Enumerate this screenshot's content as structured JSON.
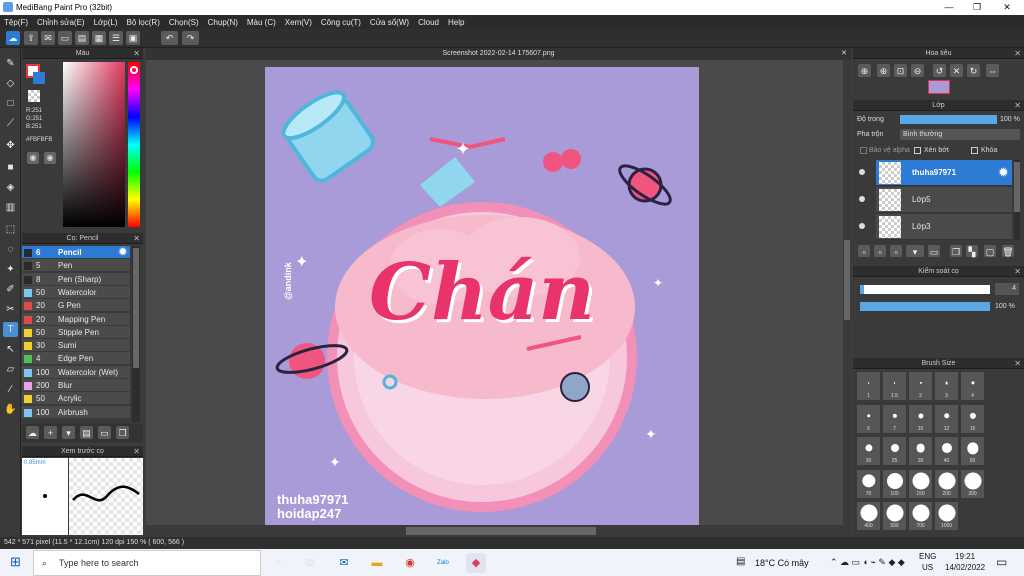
{
  "window": {
    "title": "MediBang Paint Pro (32bit)",
    "min": "—",
    "max": "❐",
    "close": "✕"
  },
  "menu": [
    "Tệp(F)",
    "Chỉnh sửa(E)",
    "Lớp(L)",
    "Bộ lọc(R)",
    "Chọn(S)",
    "Chụp(N)",
    "Màu (C)",
    "Xem(V)",
    "Công cụ(T)",
    "Cửa sổ(W)",
    "Cloud",
    "Help"
  ],
  "color_panel": {
    "title": "Màu",
    "r": "R:251",
    "g": "G:251",
    "b": "B:251",
    "hex": "#FBFBFB"
  },
  "brush_panel": {
    "title": "Cọ: Pencil",
    "items": [
      {
        "size": "6",
        "name": "Pencil",
        "color": "#2a2a2a"
      },
      {
        "size": "5",
        "name": "Pen",
        "color": "#2a2a2a"
      },
      {
        "size": "8",
        "name": "Pen (Sharp)",
        "color": "#2a2a2a"
      },
      {
        "size": "50",
        "name": "Watercolor",
        "color": "#7ec8f0"
      },
      {
        "size": "20",
        "name": "G Pen",
        "color": "#e04a4a"
      },
      {
        "size": "20",
        "name": "Mapping Pen",
        "color": "#e04a4a"
      },
      {
        "size": "50",
        "name": "Stipple Pen",
        "color": "#f0d030"
      },
      {
        "size": "30",
        "name": "Sumi",
        "color": "#f0d030"
      },
      {
        "size": "4",
        "name": "Edge Pen",
        "color": "#50c050"
      },
      {
        "size": "100",
        "name": "Watercolor (Wet)",
        "color": "#7ec8f0"
      },
      {
        "size": "200",
        "name": "Blur",
        "color": "#e8a0e8"
      },
      {
        "size": "50",
        "name": "Acrylic",
        "color": "#f0d030"
      },
      {
        "size": "100",
        "name": "Airbrush",
        "color": "#7ec8f0"
      }
    ]
  },
  "preview_panel": {
    "title": "Xem trước cọ",
    "size": "0.85mm"
  },
  "canvas": {
    "tab": "Screenshot 2022-02-14 175607.png",
    "title_text": "Chán",
    "wm1": "thuha97971",
    "wm2": "hoidap247",
    "vert": "@andink"
  },
  "navigator": {
    "title": "Hoa tiêu"
  },
  "layer_panel": {
    "title": "Lớp",
    "opacity_label": "Độ trong",
    "opacity_value": "100 %",
    "blend_label": "Pha trộn",
    "blend_value": "Bình thường",
    "protect_alpha": "Bảo vệ alpha",
    "clip": "Xén bớt",
    "lock": "Khóa",
    "layers": [
      "thuha97971",
      "Lớp5",
      "Lớp3"
    ]
  },
  "brush_control": {
    "title": "Kiểm soát cọ",
    "size_value": "4",
    "opacity_value": "100 %"
  },
  "brush_size": {
    "title": "Brush Size",
    "sizes": [
      "1",
      "1.5",
      "2",
      "3",
      "4",
      "5",
      "7",
      "10",
      "12",
      "15",
      "20",
      "25",
      "30",
      "40",
      "50",
      "70",
      "100",
      "150",
      "200",
      "300",
      "400",
      "500",
      "700",
      "1000"
    ]
  },
  "status": {
    "text": "542 * 571 pixel   (11.5 * 12.1cm)   120 dpi   150 %   ( 600, 566 )"
  },
  "taskbar": {
    "search": "Type here to search",
    "weather": "18°C  Có mây",
    "lang1": "ENG",
    "lang2": "US",
    "time": "19:21",
    "date": "14/02/2022"
  }
}
